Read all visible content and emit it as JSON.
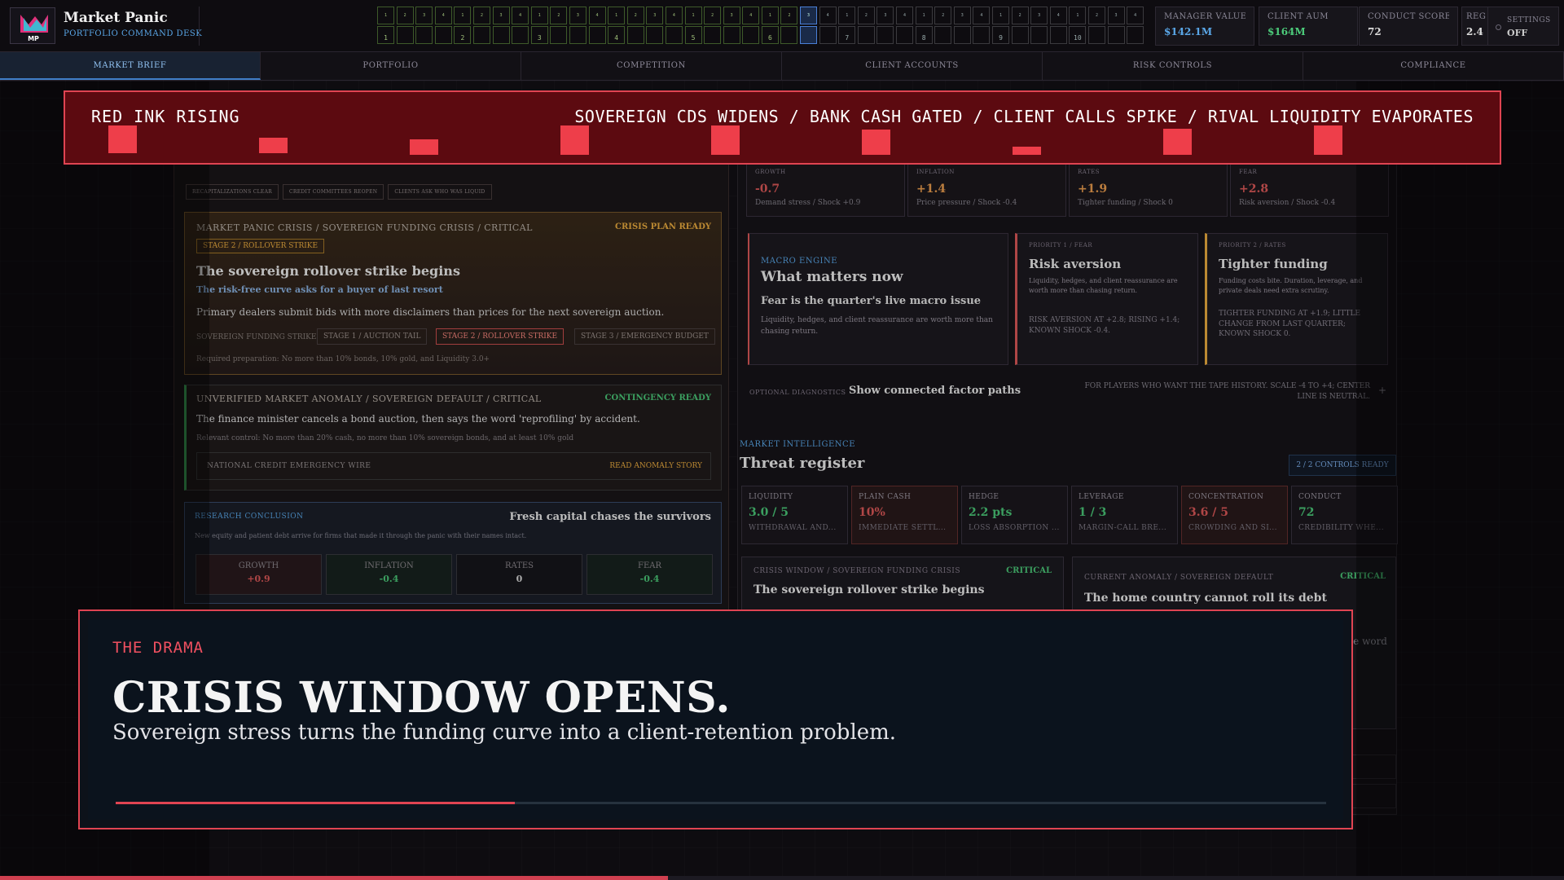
{
  "app": {
    "title": "Market Panic",
    "subtitle": "PORTFOLIO COMMAND DESK",
    "logo_text": "MP"
  },
  "timeline": {
    "top_numbers": [
      "1",
      "2",
      "3",
      "4",
      "1",
      "2",
      "3",
      "4",
      "1",
      "2",
      "3",
      "4",
      "1",
      "2",
      "3",
      "4",
      "1",
      "2",
      "3",
      "4",
      "1",
      "2",
      "3",
      "4",
      "1",
      "2",
      "3",
      "4",
      "1",
      "2",
      "3",
      "4",
      "1",
      "2",
      "3",
      "4",
      "1",
      "2",
      "3",
      "4"
    ],
    "year_labels": {
      "0": "1",
      "4": "2",
      "8": "3",
      "12": "4",
      "16": "5",
      "20": "6",
      "24": "7",
      "28": "8",
      "32": "9",
      "36": "10"
    },
    "current_index": 22
  },
  "metrics": [
    {
      "label": "MANAGER VALUE",
      "value": "$142.1M",
      "color": "#5aa7e8"
    },
    {
      "label": "CLIENT AUM",
      "value": "$164M",
      "color": "#4ccb7a"
    },
    {
      "label": "CONDUCT SCORE",
      "value": "72",
      "color": "#dddddd"
    },
    {
      "label": "REG",
      "value": "2.4",
      "color": "#dddddd"
    }
  ],
  "settings": {
    "label": "SETTINGS",
    "value": "OFF"
  },
  "tabs": [
    "MARKET BRIEF",
    "PORTFOLIO",
    "COMPETITION",
    "CLIENT ACCOUNTS",
    "RISK CONTROLS",
    "COMPLIANCE"
  ],
  "left": {
    "chips": [
      "RECAPITALIZATIONS CLEAR",
      "CREDIT COMMITTEES REOPEN",
      "CLIENTS ASK WHO WAS LIQUID"
    ],
    "crisis": {
      "title": "MARKET PANIC CRISIS / SOVEREIGN FUNDING CRISIS / CRITICAL",
      "status": "CRISIS PLAN READY",
      "badge": "STAGE 2 / ROLLOVER STRIKE",
      "headline": "The sovereign rollover strike begins",
      "subhead": "The risk-free curve asks for a buyer of last resort",
      "body": "Primary dealers submit bids with more disclaimers than prices for the next sovereign auction.",
      "strike_label": "SOVEREIGN FUNDING STRIKE",
      "stages": [
        "STAGE 1 / AUCTION TAIL",
        "STAGE 2 / ROLLOVER STRIKE",
        "STAGE 3 / EMERGENCY BUDGET"
      ],
      "prep": "Required preparation: No more than 10% bonds, 10% gold, and Liquidity 3.0+"
    },
    "anomaly": {
      "title": "UNVERIFIED MARKET ANOMALY / SOVEREIGN DEFAULT / CRITICAL",
      "status": "CONTINGENCY READY",
      "body": "The finance minister cancels a bond auction, then says the word 'reprofiling' by accident.",
      "control": "Relevant control: No more than 20% cash, no more than 10% sovereign bonds, and at least 10% gold",
      "wire": "NATIONAL CREDIT EMERGENCY WIRE",
      "link": "READ ANOMALY STORY"
    },
    "research": {
      "label": "RESEARCH CONCLUSION",
      "title": "Fresh capital chases the survivors",
      "body": "New equity and patient debt arrive for firms that made it through the panic with their names intact.",
      "factors": [
        {
          "name": "GROWTH",
          "value": "+0.9",
          "color": "#e05a5a",
          "bg": "#2a1a1e"
        },
        {
          "name": "INFLATION",
          "value": "-0.4",
          "color": "#4ccb7a",
          "bg": "#18231f"
        },
        {
          "name": "RATES",
          "value": "0",
          "color": "#dddddd",
          "bg": "#17171c"
        },
        {
          "name": "FEAR",
          "value": "-0.4",
          "color": "#4ccb7a",
          "bg": "#18231f"
        }
      ]
    }
  },
  "right": {
    "shocks": [
      {
        "label": "GROWTH",
        "value": "-0.7",
        "color": "#e05a5a",
        "desc": "Demand stress / Shock +0.9"
      },
      {
        "label": "INFLATION",
        "value": "+1.4",
        "color": "#f0a050",
        "desc": "Price pressure / Shock -0.4"
      },
      {
        "label": "RATES",
        "value": "+1.9",
        "color": "#f0a050",
        "desc": "Tighter funding / Shock 0"
      },
      {
        "label": "FEAR",
        "value": "+2.8",
        "color": "#e05a5a",
        "desc": "Risk aversion / Shock -0.4"
      }
    ],
    "macro": {
      "label": "MACRO ENGINE",
      "title": "What matters now",
      "subtitle": "Fear is the quarter's live macro issue",
      "body": "Liquidity, hedges, and client reassurance are worth more than chasing return."
    },
    "priorities": [
      {
        "label": "PRIORITY 1 / FEAR",
        "title": "Risk aversion",
        "body": "Liquidity, hedges, and client reassurance are worth more than chasing return.",
        "note": "RISK AVERSION AT +2.8; RISING +1.4; KNOWN SHOCK -0.4.",
        "accent": "#e05a5a"
      },
      {
        "label": "PRIORITY 2 / RATES",
        "title": "Tighter funding",
        "body": "Funding costs bite. Duration, leverage, and private deals need extra scrutiny.",
        "note": "TIGHTER FUNDING AT +1.9; LITTLE CHANGE FROM LAST QUARTER; KNOWN SHOCK 0.",
        "accent": "#f0b040"
      }
    ],
    "diagnostics": {
      "label": "OPTIONAL DIAGNOSTICS",
      "title": "Show connected factor paths",
      "note": "FOR PLAYERS WHO WANT THE TAPE HISTORY. SCALE -4 TO +4; CENTER LINE IS NEUTRAL.",
      "toggle": "+"
    },
    "intel": {
      "label": "MARKET INTELLIGENCE",
      "title": "Threat register",
      "status": "2 / 2 CONTROLS READY"
    },
    "threats": [
      {
        "label": "LIQUIDITY",
        "value": "3.0 / 5",
        "color": "#4ccb7a",
        "desc": "WITHDRAWAL AND...",
        "red": false
      },
      {
        "label": "PLAIN CASH",
        "value": "10%",
        "color": "#e05a5a",
        "desc": "IMMEDIATE SETTL...",
        "red": true
      },
      {
        "label": "HEDGE",
        "value": "2.2 pts",
        "color": "#4ccb7a",
        "desc": "LOSS ABSORPTION ...",
        "red": false
      },
      {
        "label": "LEVERAGE",
        "value": "1 / 3",
        "color": "#4ccb7a",
        "desc": "MARGIN-CALL BRE...",
        "red": false
      },
      {
        "label": "CONCENTRATION",
        "value": "3.6 / 5",
        "color": "#e05a5a",
        "desc": "CROWDING AND SI...",
        "red": true
      },
      {
        "label": "CONDUCT",
        "value": "72",
        "color": "#4ccb7a",
        "desc": "CREDIBILITY WHE...",
        "red": false
      }
    ],
    "window": {
      "label": "CRISIS WINDOW / SOVEREIGN FUNDING CRISIS",
      "status": "CRITICAL",
      "title": "The sovereign rollover strike begins"
    },
    "current": {
      "label": "CURRENT ANOMALY / SOVEREIGN DEFAULT",
      "status": "CRITICAL",
      "title": "The home country cannot roll its debt",
      "tail": "e word"
    }
  },
  "ticker": {
    "left": "RED INK RISING",
    "right": "SOVEREIGN CDS WIDENS / BANK CASH GATED / CLIENT CALLS SPIKE / RIVAL LIQUIDITY EVAPORATES"
  },
  "drama": {
    "kicker": "THE DRAMA",
    "title": "CRISIS WINDOW OPENS.",
    "subtitle": "Sovereign stress turns the funding curve into a client-retention problem.",
    "progress": 0.33
  },
  "page_progress": 0.427,
  "colors": {
    "accent": "#e04452",
    "blue": "#5aa7e8",
    "green": "#4ccb7a",
    "red": "#e05a5a",
    "amber": "#f0b040"
  }
}
